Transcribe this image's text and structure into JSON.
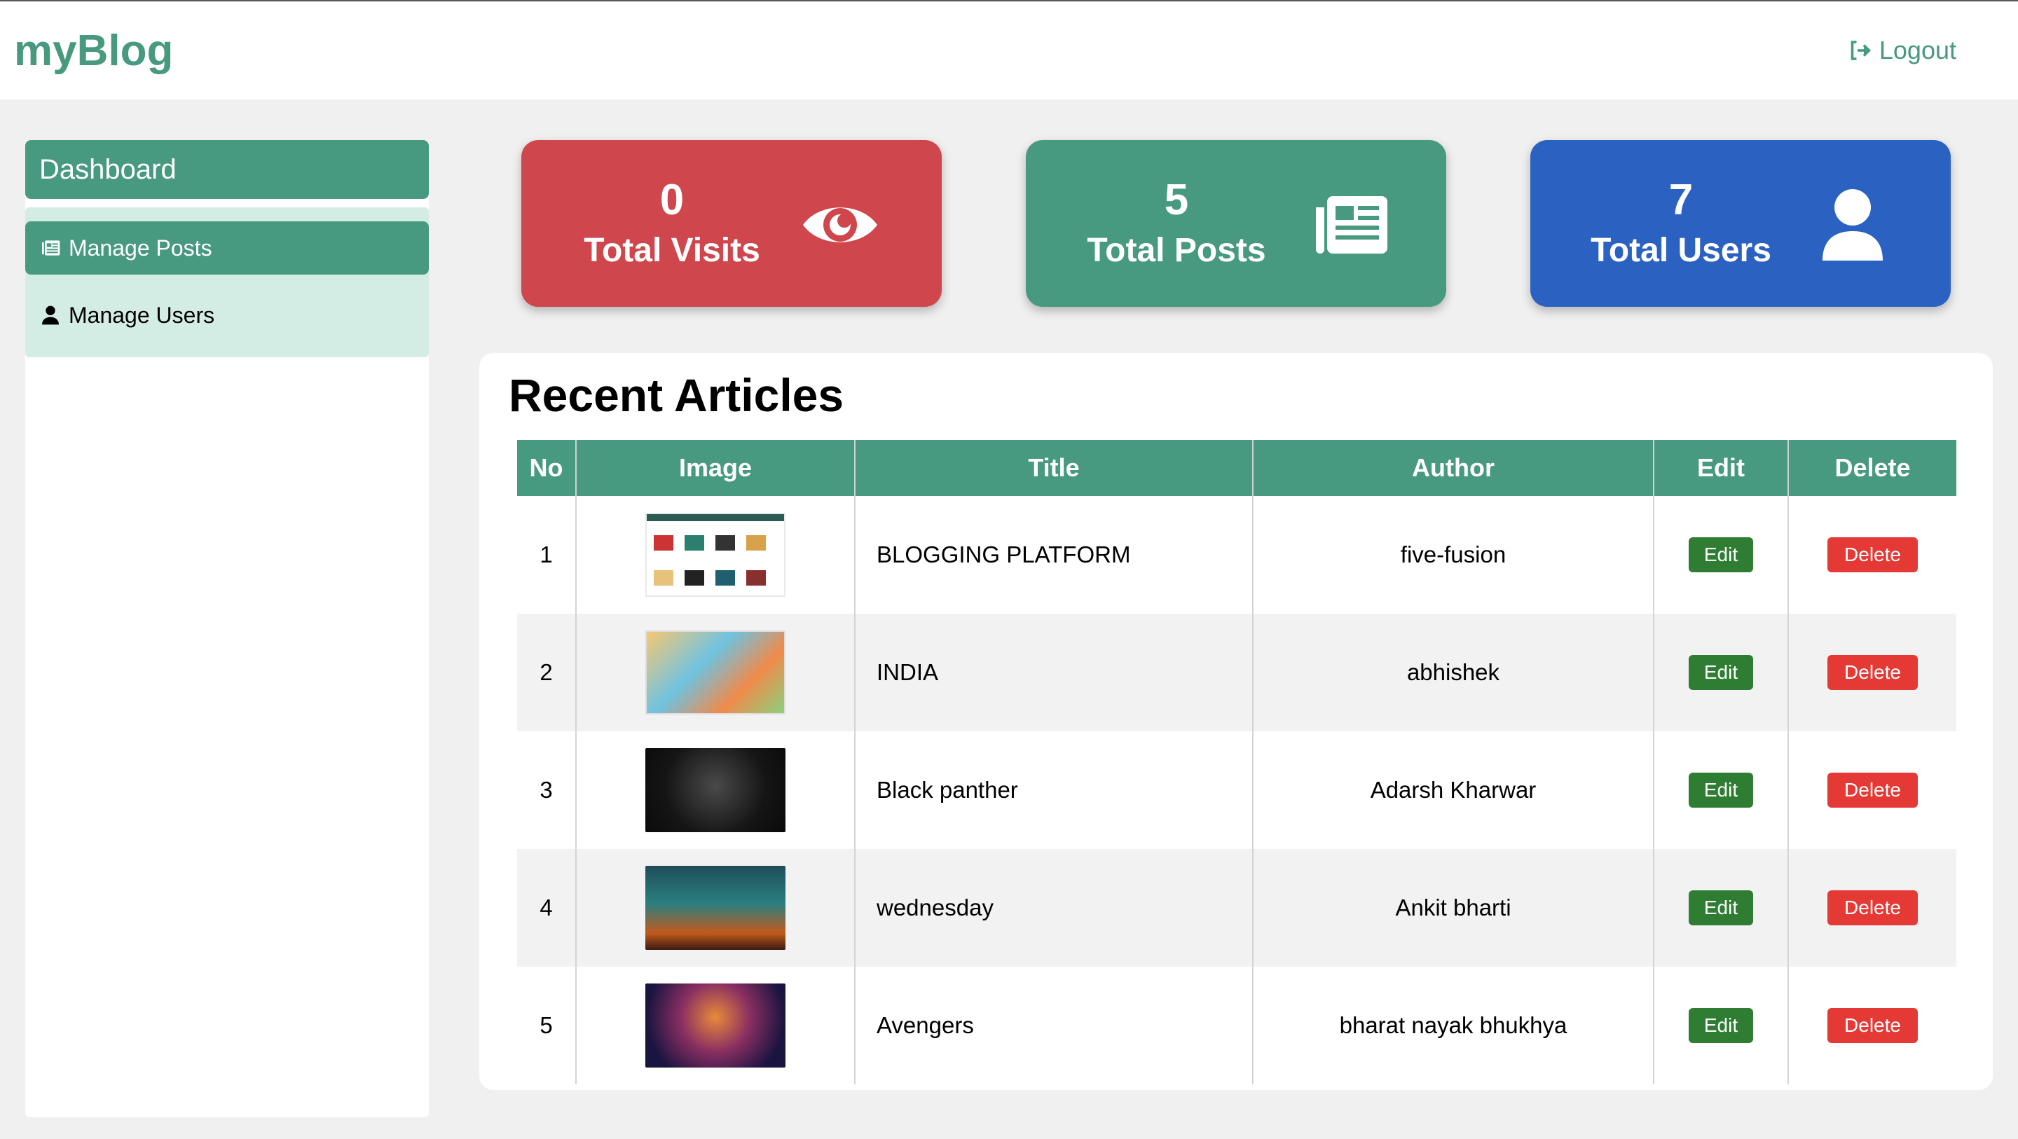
{
  "app": {
    "brand": "myBlog",
    "logout_label": "Logout",
    "logout_icon": "sign-out-icon"
  },
  "sidebar": {
    "dashboard_label": "Dashboard",
    "items": [
      {
        "label": "Manage Posts",
        "icon": "newspaper-icon",
        "active": true
      },
      {
        "label": "Manage Users",
        "icon": "user-icon",
        "active": false
      }
    ]
  },
  "stats": [
    {
      "value": "0",
      "label": "Total Visits",
      "icon": "eye-icon",
      "color": "#cf464d"
    },
    {
      "value": "5",
      "label": "Total Posts",
      "icon": "newspaper-icon",
      "color": "#47997f"
    },
    {
      "value": "7",
      "label": "Total Users",
      "icon": "user-icon",
      "color": "#2b62c2"
    }
  ],
  "articles": {
    "title": "Recent Articles",
    "columns": [
      "No",
      "Image",
      "Title",
      "Author",
      "Edit",
      "Delete"
    ],
    "edit_label": "Edit",
    "delete_label": "Delete",
    "rows": [
      {
        "no": "1",
        "title": "BLOGGING PLATFORM",
        "author": "five-fusion"
      },
      {
        "no": "2",
        "title": "INDIA",
        "author": "abhishek"
      },
      {
        "no": "3",
        "title": "Black panther",
        "author": "Adarsh Kharwar"
      },
      {
        "no": "4",
        "title": "wednesday",
        "author": "Ankit bharti"
      },
      {
        "no": "5",
        "title": "Avengers",
        "author": "bharat nayak bhukhya"
      }
    ]
  },
  "colors": {
    "accent": "#47997f",
    "edit": "#2e7d32",
    "delete": "#e53935"
  }
}
